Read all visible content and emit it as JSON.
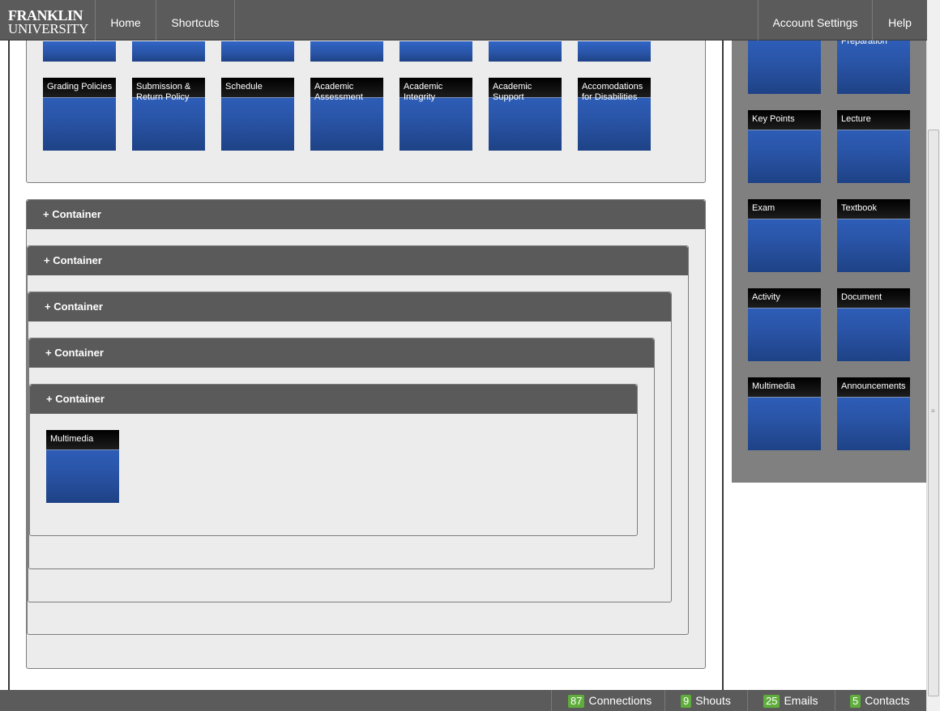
{
  "header": {
    "logo_line1": "FRANKLIN",
    "logo_line2": "UNIVERSITY",
    "nav_home": "Home",
    "nav_shortcuts": "Shortcuts",
    "nav_account": "Account Settings",
    "nav_help": "Help"
  },
  "top_tiles": [
    "Grading Policies",
    "Submission &\nReturn Policy",
    "Schedule",
    "Academic\nAssessment",
    "Academic\nIntegrity",
    "Academic\nSupport",
    "Accomodations\nfor Disabilities"
  ],
  "containers": {
    "c1": "+ Container",
    "c2": "+ Container",
    "c3": "+ Container",
    "c4": "+ Container",
    "c5": "+ Container"
  },
  "inner_tile": "Multimedia",
  "sidebar": {
    "partial_tile": "Preparation",
    "tiles": [
      "Key Points",
      "Lecture",
      "Exam",
      "Textbook",
      "Activity",
      "Document",
      "Multimedia",
      "Announcements"
    ]
  },
  "footer": {
    "connections_count": "87",
    "connections_label": "Connections",
    "shouts_count": "9",
    "shouts_label": "Shouts",
    "emails_count": "25",
    "emails_label": "Emails",
    "contacts_count": "5",
    "contacts_label": "Contacts"
  },
  "colors": {
    "tile_blue": "#2a55a8",
    "bar_gray": "#5b5b5b",
    "badge_green": "#5fae3c"
  }
}
